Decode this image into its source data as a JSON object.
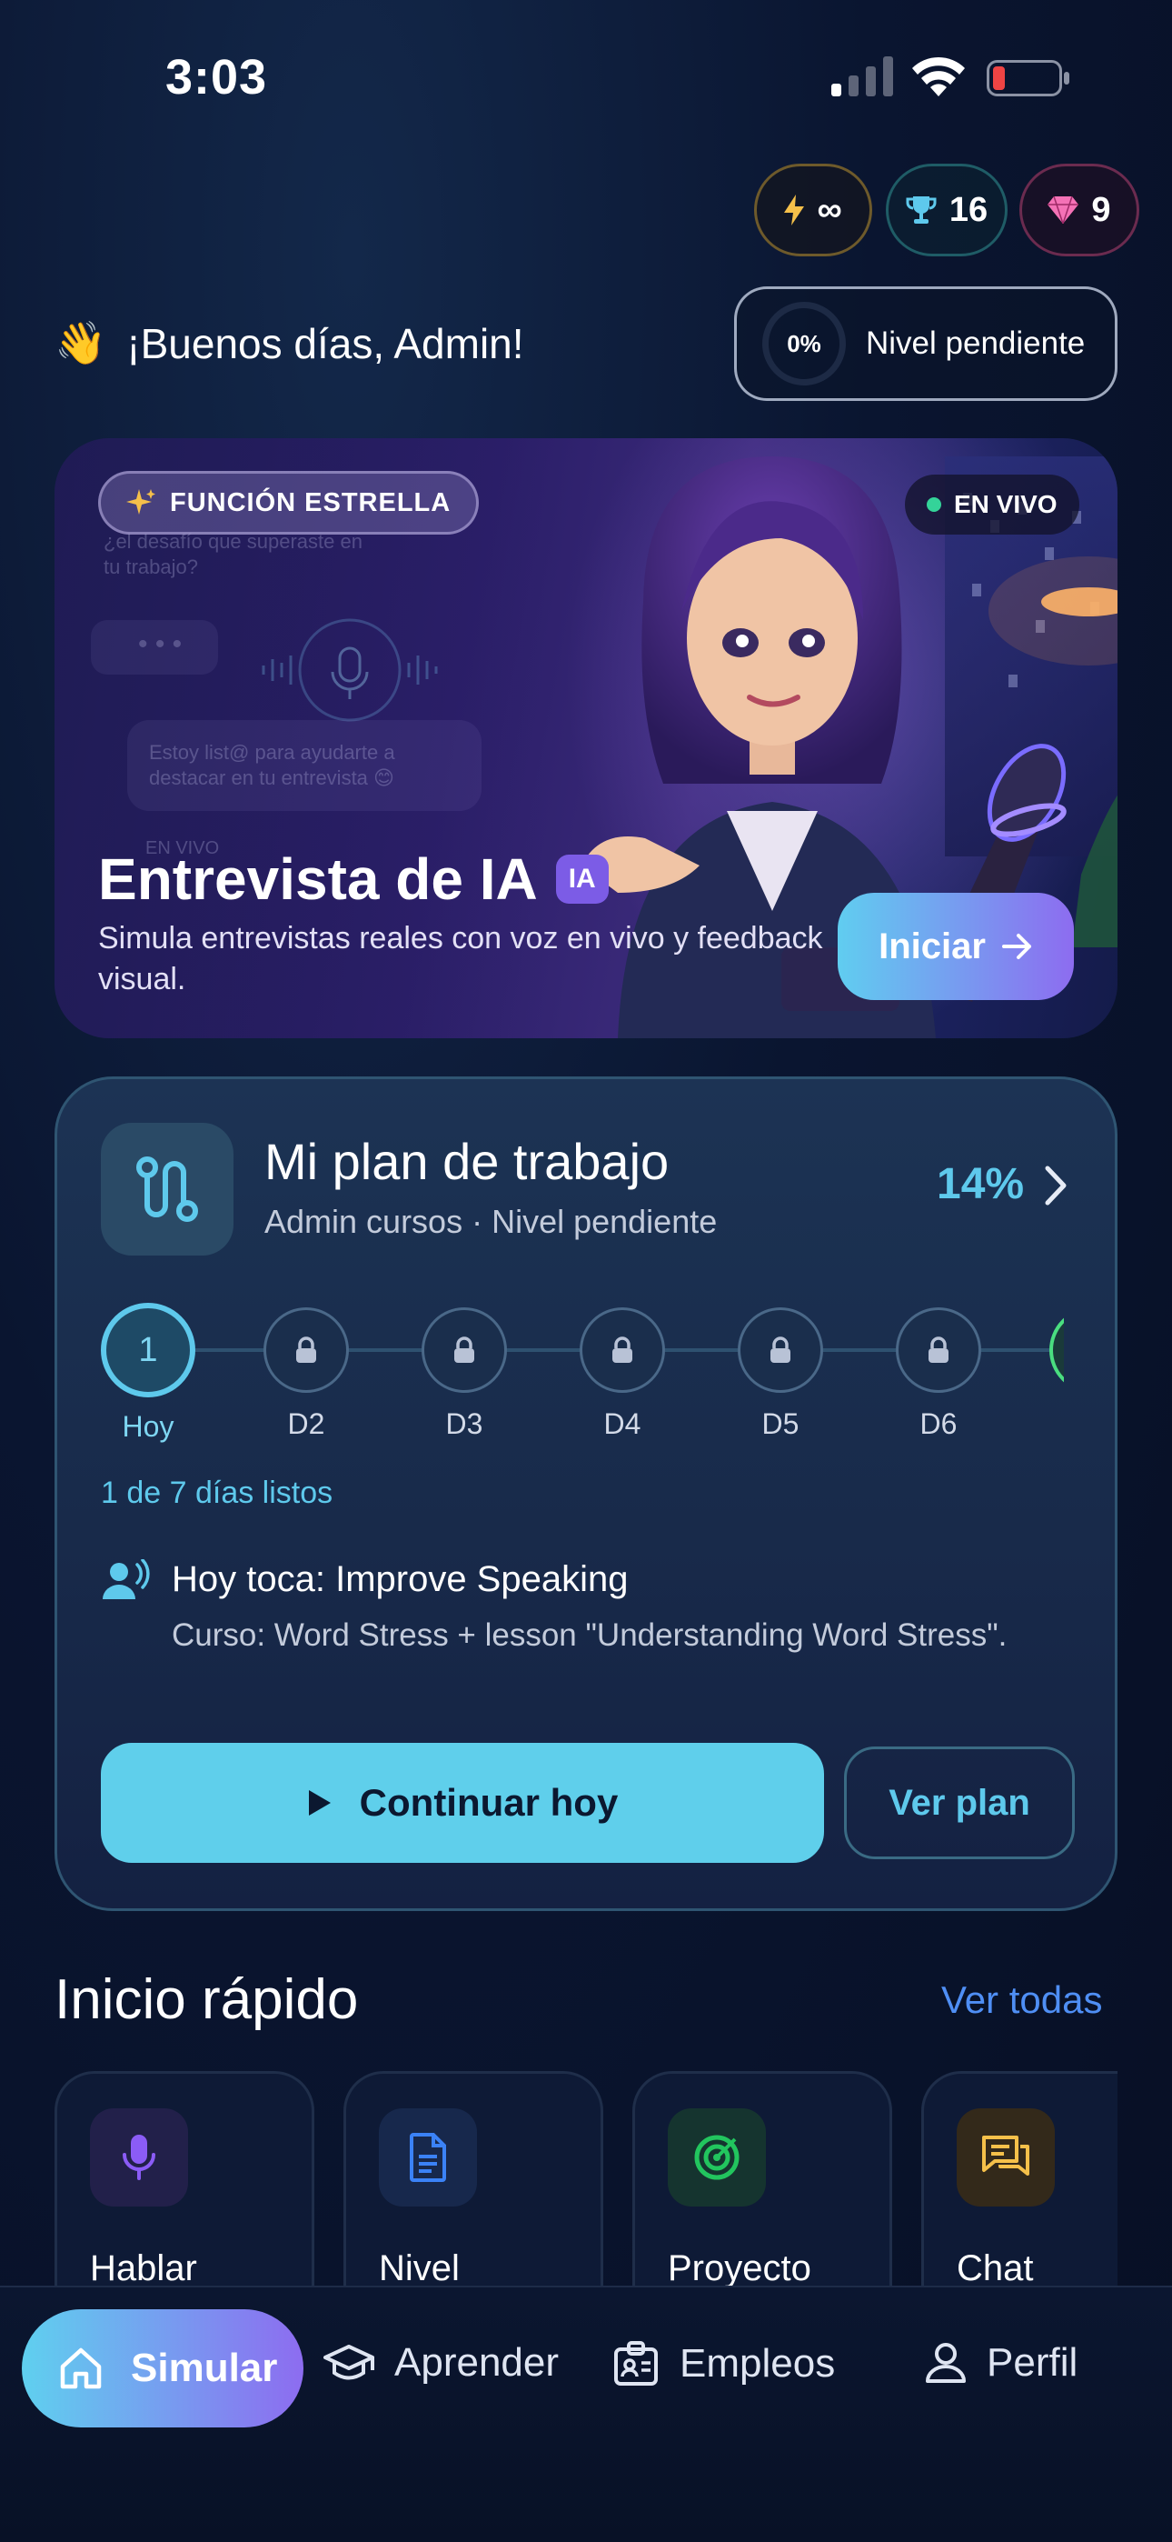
{
  "status_bar": {
    "time": "3:03"
  },
  "stats": {
    "energy": "∞",
    "trophies": "16",
    "gems": "9"
  },
  "greeting": {
    "emoji": "👋",
    "text": "¡Buenos días, Admin!"
  },
  "level": {
    "percent": "0%",
    "label": "Nivel pendiente"
  },
  "hero": {
    "badge": "FUNCIÓN ESTRELLA",
    "live": "EN VIVO",
    "title": "Entrevista de IA",
    "ia_badge": "IA",
    "subtitle": "Simula entrevistas reales con voz en vivo y feedback visual.",
    "button": "Iniciar",
    "ghost_question": "¿el desafío que superaste en tu trabajo?",
    "ghost_dots": "• • •",
    "ghost_reply": "Estoy list@ para ayudarte a destacar en tu entrevista 😊",
    "ghost_live": "EN VIVO"
  },
  "plan": {
    "title": "Mi plan de trabajo",
    "subtitle": "Admin cursos · Nivel pendiente",
    "percent": "14%",
    "current_day_number": "1",
    "current_day_label": "Hoy",
    "days": [
      "D2",
      "D3",
      "D4",
      "D5",
      "D6"
    ],
    "days_ready": "1 de 7 días listos",
    "today_title": "Hoy toca: Improve Speaking",
    "today_desc": "Curso: Word Stress + lesson \"Understanding Word Stress\".",
    "continue_button": "Continuar hoy",
    "view_plan_button": "Ver plan"
  },
  "quick_start": {
    "title": "Inicio rápido",
    "see_all": "Ver todas",
    "items": [
      {
        "label": "Hablar",
        "icon": "microphone-icon",
        "color": "#8b5cf6"
      },
      {
        "label": "Nivel",
        "icon": "document-icon",
        "color": "#3b82f6"
      },
      {
        "label": "Proyecto",
        "icon": "target-icon",
        "color": "#22c55e"
      },
      {
        "label": "Chat",
        "icon": "chat-icon",
        "color": "#f5c04a"
      }
    ]
  },
  "nav": {
    "simular": "Simular",
    "aprender": "Aprender",
    "empleos": "Empleos",
    "perfil": "Perfil"
  },
  "colors": {
    "accent": "#5fcfeb",
    "purple": "#8d6cf0",
    "background": "#0a1530"
  }
}
